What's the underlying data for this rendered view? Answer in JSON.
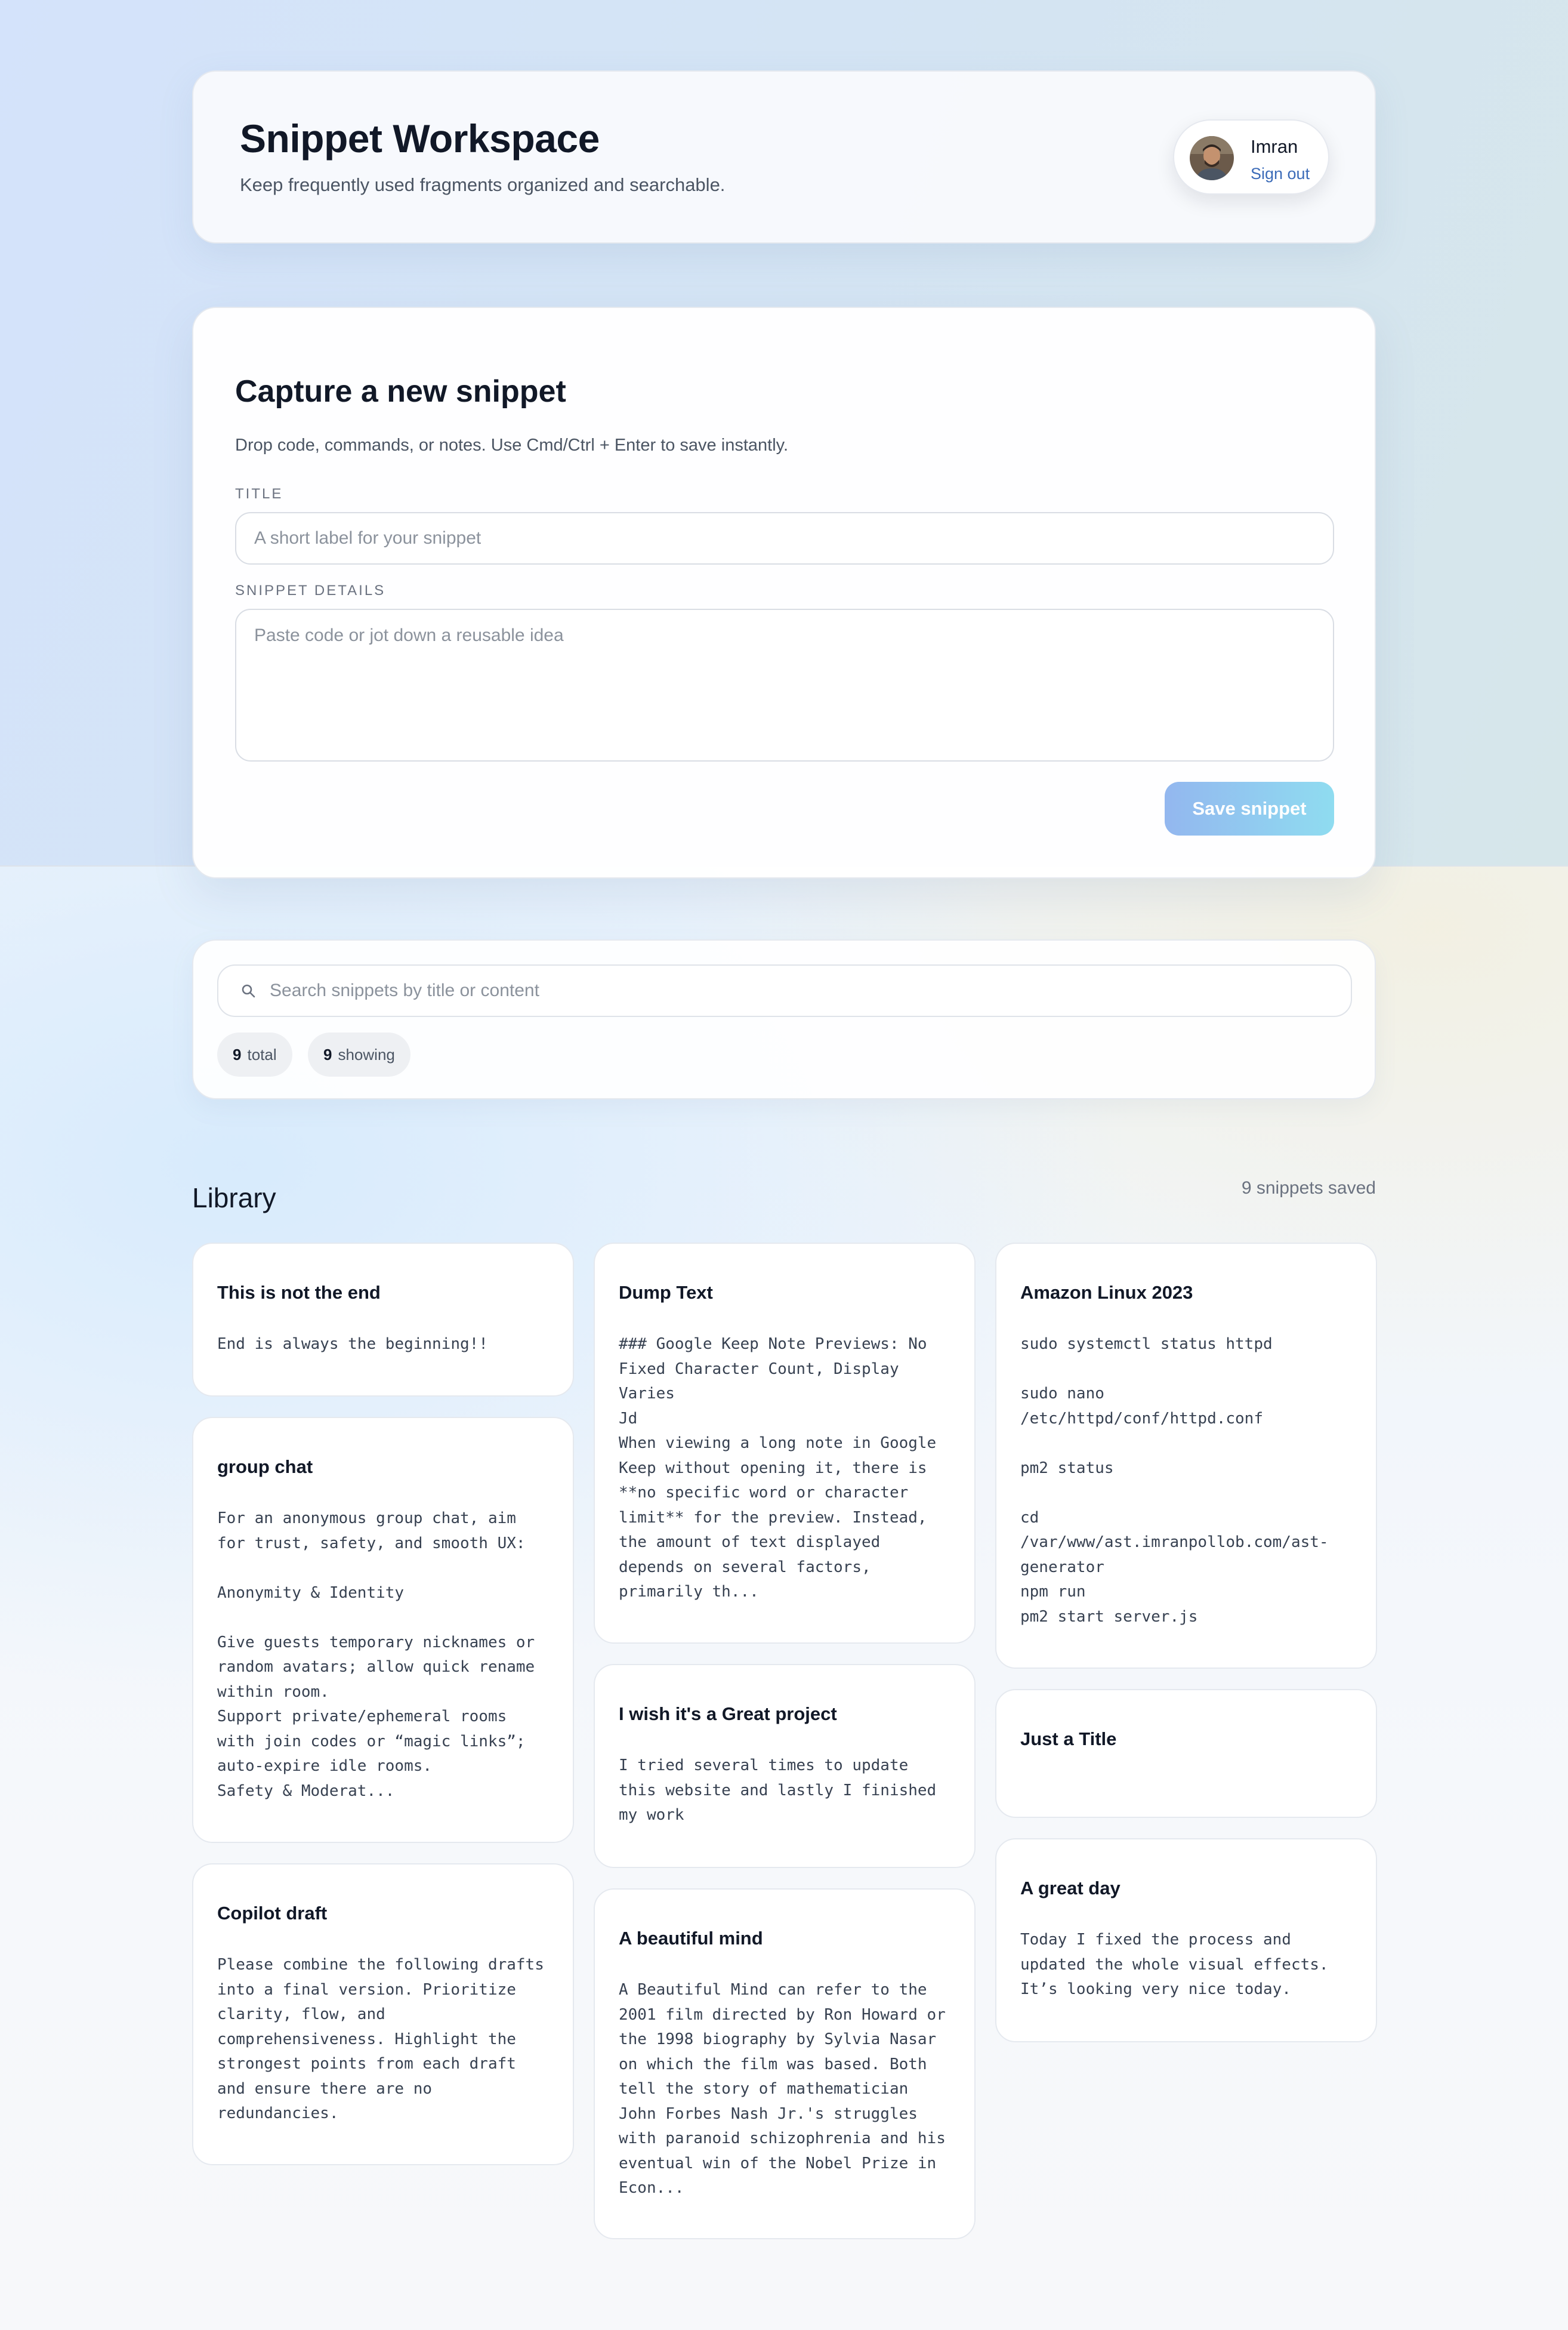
{
  "header": {
    "title": "Snippet Workspace",
    "subtitle": "Keep frequently used fragments organized and searchable.",
    "user": {
      "name": "Imran",
      "sign_out": "Sign out"
    }
  },
  "capture": {
    "title": "Capture a new snippet",
    "hint": "Drop code, commands, or notes. Use Cmd/Ctrl + Enter to save instantly.",
    "title_label": "TITLE",
    "title_placeholder": "A short label for your snippet",
    "details_label": "SNIPPET DETAILS",
    "details_placeholder": "Paste code or jot down a reusable idea",
    "save_label": "Save snippet"
  },
  "search": {
    "placeholder": "Search snippets by title or content",
    "total_count": "9",
    "total_label": "total",
    "showing_count": "9",
    "showing_label": "showing"
  },
  "library": {
    "title": "Library",
    "count_text": "9 snippets saved",
    "columns": [
      [
        {
          "title": "This is not the end",
          "body": "End is always the beginning!!"
        },
        {
          "title": "group chat",
          "body": "For an anonymous group chat, aim\nfor trust, safety, and smooth UX:\n\nAnonymity & Identity\n\nGive guests temporary nicknames or\nrandom avatars; allow quick rename\nwithin room.\nSupport private/ephemeral rooms\nwith join codes or “magic links”;\nauto-expire idle rooms.\nSafety & Moderat..."
        },
        {
          "title": "Copilot draft",
          "body": "Please combine the following drafts\ninto a final version. Prioritize\nclarity, flow, and\ncomprehensiveness. Highlight the\nstrongest points from each draft\nand ensure there are no\nredundancies."
        }
      ],
      [
        {
          "title": "Dump Text",
          "body": "### Google Keep Note Previews: No\nFixed Character Count, Display\nVaries\nJd\nWhen viewing a long note in Google\nKeep without opening it, there is\n**no specific word or character\nlimit** for the preview. Instead,\nthe amount of text displayed\ndepends on several factors,\nprimarily th..."
        },
        {
          "title": "I wish it's a Great project",
          "body": "I tried several times to update\nthis website and lastly I finished\nmy work"
        },
        {
          "title": "A beautiful mind",
          "body": "A Beautiful Mind can refer to the\n2001 film directed by Ron Howard or\nthe 1998 biography by Sylvia Nasar\non which the film was based. Both\ntell the story of mathematician\nJohn Forbes Nash Jr.'s struggles\nwith paranoid schizophrenia and his\neventual win of the Nobel Prize in\nEcon..."
        }
      ],
      [
        {
          "title": "Amazon Linux 2023",
          "body": "sudo systemctl status httpd\n\nsudo nano\n/etc/httpd/conf/httpd.conf\n\npm2 status\n\ncd\n/var/www/ast.imranpollob.com/ast-\ngenerator\nnpm run\npm2 start server.js"
        },
        {
          "title": "Just a Title",
          "body": ""
        },
        {
          "title": "A great day",
          "body": "Today I fixed the process and\nupdated the whole visual effects.\nIt’s looking very nice today."
        }
      ]
    ]
  }
}
